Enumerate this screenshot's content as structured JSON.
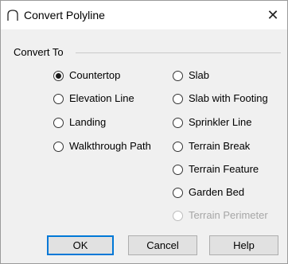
{
  "window": {
    "title": "Convert Polyline",
    "close_glyph": "✕"
  },
  "group": {
    "label": "Convert To"
  },
  "options_left": [
    {
      "label": "Countertop",
      "checked": true
    },
    {
      "label": "Elevation Line",
      "checked": false
    },
    {
      "label": "Landing",
      "checked": false
    },
    {
      "label": "Walkthrough Path",
      "checked": false
    }
  ],
  "options_right": [
    {
      "label": "Slab",
      "checked": false
    },
    {
      "label": "Slab with Footing",
      "checked": false
    },
    {
      "label": "Sprinkler Line",
      "checked": false
    },
    {
      "label": "Terrain Break",
      "checked": false
    },
    {
      "label": "Terrain Feature",
      "checked": false
    },
    {
      "label": "Garden Bed",
      "checked": false
    },
    {
      "label": "Terrain Perimeter",
      "checked": false,
      "disabled": true
    }
  ],
  "buttons": {
    "ok": "OK",
    "cancel": "Cancel",
    "help": "Help"
  },
  "colors": {
    "default_button_border": "#0078d7",
    "disabled_text": "#a6a6a6"
  }
}
